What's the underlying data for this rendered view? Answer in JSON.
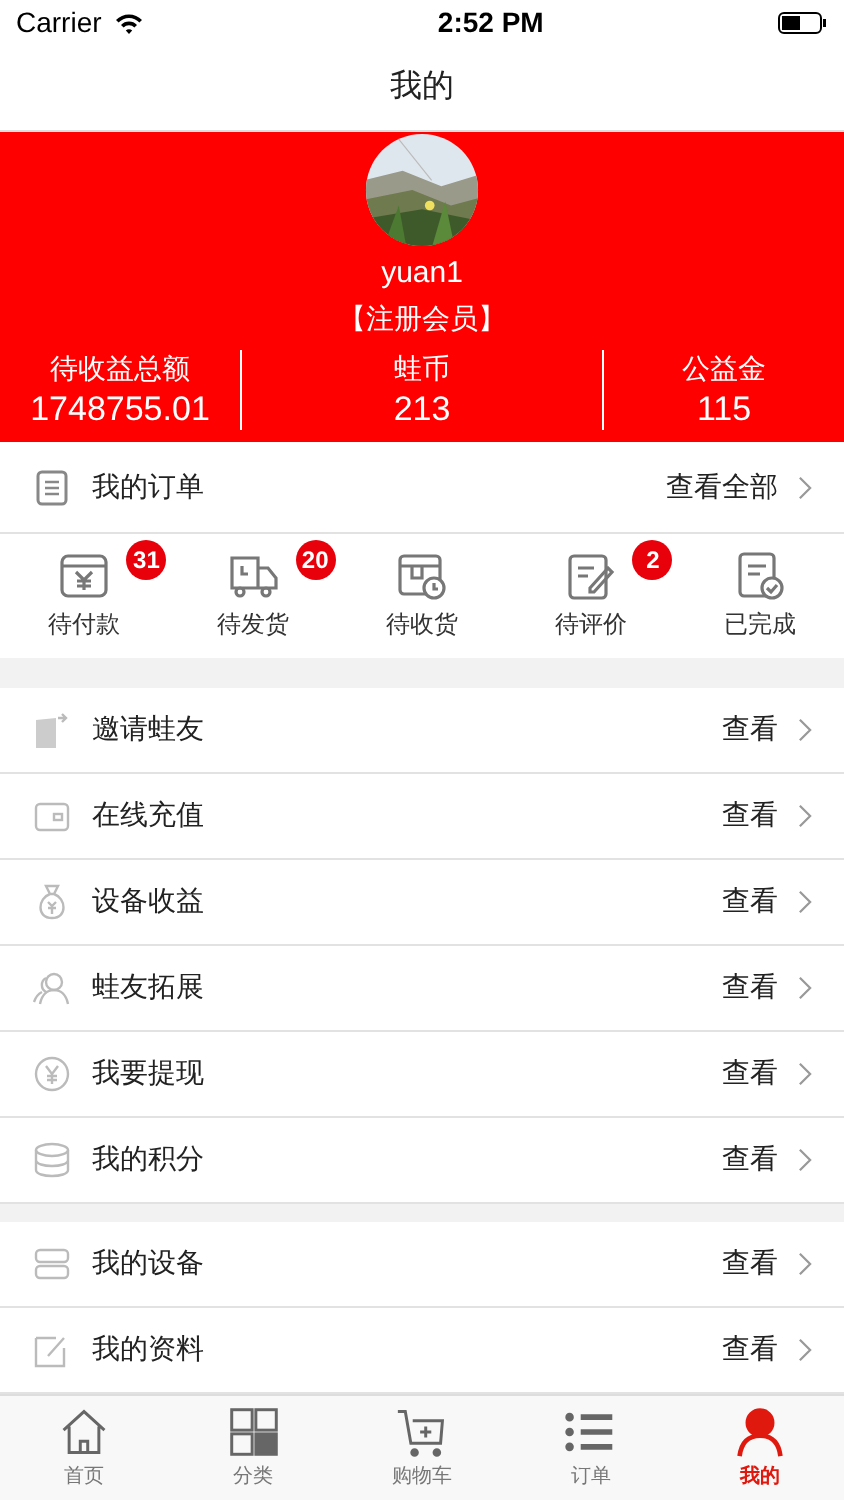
{
  "status_bar": {
    "carrier": "Carrier",
    "time": "2:52 PM"
  },
  "nav": {
    "title": "我的"
  },
  "profile": {
    "username": "yuan1",
    "member_level": "【注册会员】",
    "stats": [
      {
        "label": "待收益总额",
        "value": "1748755.01"
      },
      {
        "label": "蛙币",
        "value": "213"
      },
      {
        "label": "公益金",
        "value": "115"
      }
    ]
  },
  "orders": {
    "title": "我的订单",
    "view_all": "查看全部",
    "statuses": [
      {
        "label": "待付款",
        "badge": "31"
      },
      {
        "label": "待发货",
        "badge": "20"
      },
      {
        "label": "待收货"
      },
      {
        "label": "待评价",
        "badge": "2"
      },
      {
        "label": "已完成"
      }
    ]
  },
  "menu_groups": [
    [
      {
        "label": "邀请蛙友",
        "action": "查看"
      },
      {
        "label": "在线充值",
        "action": "查看"
      },
      {
        "label": "设备收益",
        "action": "查看"
      },
      {
        "label": "蛙友拓展",
        "action": "查看"
      },
      {
        "label": "我要提现",
        "action": "查看"
      },
      {
        "label": "我的积分",
        "action": "查看"
      }
    ],
    [
      {
        "label": "我的设备",
        "action": "查看"
      },
      {
        "label": "我的资料",
        "action": "查看"
      }
    ]
  ],
  "tab_bar": [
    {
      "label": "首页",
      "selected": false
    },
    {
      "label": "分类",
      "selected": false
    },
    {
      "label": "购物车",
      "selected": false
    },
    {
      "label": "订单",
      "selected": false
    },
    {
      "label": "我的",
      "selected": true
    }
  ]
}
